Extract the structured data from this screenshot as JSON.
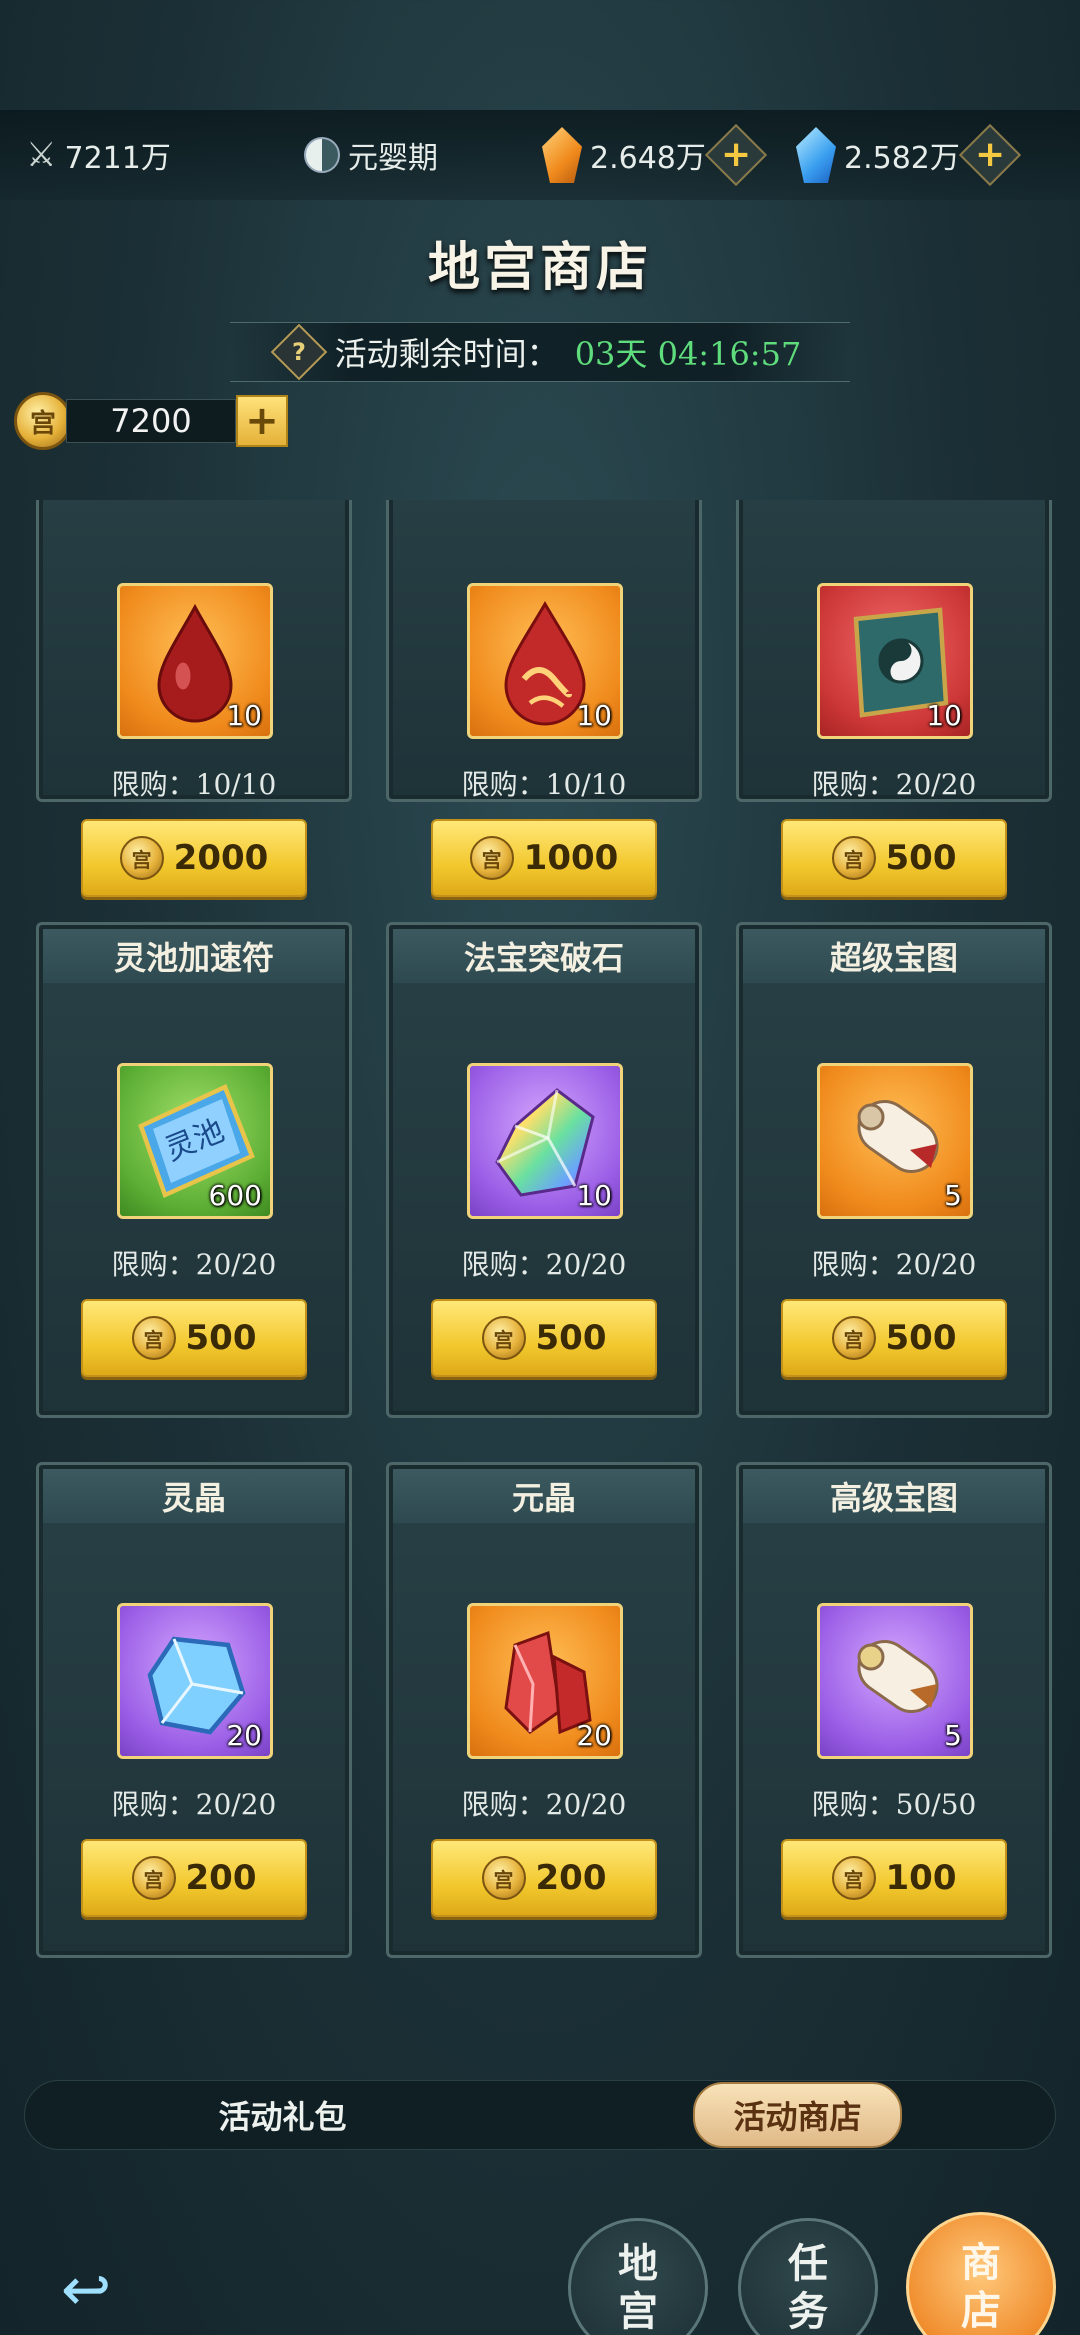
{
  "status": {
    "power": "7211万",
    "realm": "元婴期",
    "currency_orange": "2.648万",
    "currency_blue": "2.582万"
  },
  "shop": {
    "title": "地宫商店",
    "timer_label": "活动剩余时间：",
    "timer_value": "03天 04:16:57",
    "currency_glyph": "宫",
    "currency_amount": "7200",
    "add_label": "+"
  },
  "limit_prefix": "限购：",
  "items": [
    {
      "name": "",
      "qty": "10",
      "limit": "限购：10/10",
      "price": "2000",
      "bg": "orange",
      "icon": "blood-drop-icon"
    },
    {
      "name": "",
      "qty": "10",
      "limit": "限购：10/10",
      "price": "1000",
      "bg": "orange",
      "icon": "ornate-blood-drop-icon"
    },
    {
      "name": "",
      "qty": "10",
      "limit": "限购：20/20",
      "price": "500",
      "bg": "red",
      "icon": "taiji-book-icon"
    },
    {
      "name": "灵池加速符",
      "qty": "600",
      "limit": "限购：20/20",
      "price": "500",
      "bg": "green",
      "icon": "talisman-scroll-icon"
    },
    {
      "name": "法宝突破石",
      "qty": "10",
      "limit": "限购：20/20",
      "price": "500",
      "bg": "purple",
      "icon": "rainbow-crystal-icon"
    },
    {
      "name": "超级宝图",
      "qty": "5",
      "limit": "限购：20/20",
      "price": "500",
      "bg": "orange",
      "icon": "treasure-map-scroll-icon"
    },
    {
      "name": "灵晶",
      "qty": "20",
      "limit": "限购：20/20",
      "price": "200",
      "bg": "purple",
      "icon": "blue-crystal-icon"
    },
    {
      "name": "元晶",
      "qty": "20",
      "limit": "限购：20/20",
      "price": "200",
      "bg": "orange",
      "icon": "red-crystal-icon"
    },
    {
      "name": "高级宝图",
      "qty": "5",
      "limit": "限购：50/50",
      "price": "100",
      "bg": "purple",
      "icon": "treasure-map-scroll-icon"
    }
  ],
  "tabs": {
    "gift": "活动礼包",
    "shop": "活动商店"
  },
  "nav": {
    "dungeon": [
      "地",
      "宫"
    ],
    "task": [
      "任",
      "务"
    ],
    "shop": [
      "商",
      "店"
    ]
  }
}
